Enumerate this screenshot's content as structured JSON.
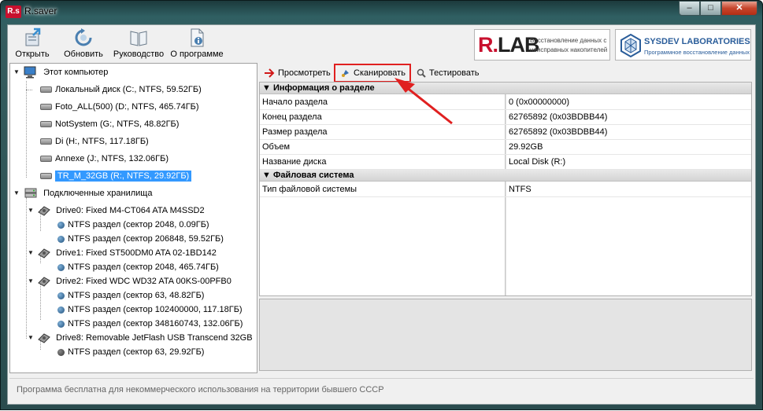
{
  "window": {
    "app_icon_text": "R.s",
    "title": "R.saver",
    "min": "–",
    "max": "□",
    "close": "✕"
  },
  "toolbar": {
    "open": "Открыть",
    "update": "Обновить",
    "manual": "Руководство",
    "about": "О программе"
  },
  "logos": {
    "rlab_mark_r": "R.",
    "rlab_mark_lab": "LAB",
    "rlab_text": "Восстановление данных с неисправных накопителей",
    "sysdev_title": "SYSDEV LABORATORIES",
    "sysdev_sub": "Программное восстановление данных"
  },
  "tree": {
    "computer": "Этот компьютер",
    "disks": [
      "Локальный диск (C:, NTFS, 59.52ГБ)",
      "Foto_ALL(500) (D:, NTFS, 465.74ГБ)",
      "NotSystem (G:, NTFS, 48.82ГБ)",
      "Di (H:, NTFS, 117.18ГБ)",
      "Annexe (J:, NTFS, 132.06ГБ)",
      "TR_M_32GB (R:, NTFS, 29.92ГБ)"
    ],
    "storages": "Подключенные хранилища",
    "drives": [
      {
        "name": "Drive0: Fixed M4-CT064 ATA M4SSD2",
        "parts": [
          "NTFS раздел (сектор 2048, 0.09ГБ)",
          "NTFS раздел (сектор 206848, 59.52ГБ)"
        ]
      },
      {
        "name": "Drive1: Fixed ST500DM0 ATA 02-1BD142",
        "parts": [
          "NTFS раздел (сектор 2048, 465.74ГБ)"
        ]
      },
      {
        "name": "Drive2: Fixed WDC WD32 ATA 00KS-00PFB0",
        "parts": [
          "NTFS раздел (сектор 63, 48.82ГБ)",
          "NTFS раздел (сектор 102400000, 117.18ГБ)",
          "NTFS раздел (сектор 348160743, 132.06ГБ)"
        ]
      },
      {
        "name": "Drive8: Removable JetFlash USB Transcend 32GB",
        "parts": [
          "NTFS раздел (сектор 63, 29.92ГБ)"
        ]
      }
    ]
  },
  "actions": {
    "view": "Просмотреть",
    "scan": "Сканировать",
    "test": "Тестировать"
  },
  "props": {
    "section1": "Информация о разделе",
    "rows1": [
      {
        "k": "Начало раздела",
        "v": "0 (0x00000000)"
      },
      {
        "k": "Конец раздела",
        "v": "62765892 (0x03BDBB44)"
      },
      {
        "k": "Размер раздела",
        "v": "62765892 (0x03BDBB44)"
      },
      {
        "k": "Объем",
        "v": "29.92GB"
      },
      {
        "k": "Название диска",
        "v": "Local Disk (R:)"
      }
    ],
    "section2": "Файловая система",
    "rows2": [
      {
        "k": "Тип файловой системы",
        "v": "NTFS"
      }
    ]
  },
  "status": "Программа бесплатна для некоммерческого использования на территории бывшего СССР",
  "colors": {
    "highlight": "#e02020",
    "selection": "#3399ff",
    "rlab_red": "#c8102e",
    "sysdev_blue": "#2a5d9a"
  }
}
